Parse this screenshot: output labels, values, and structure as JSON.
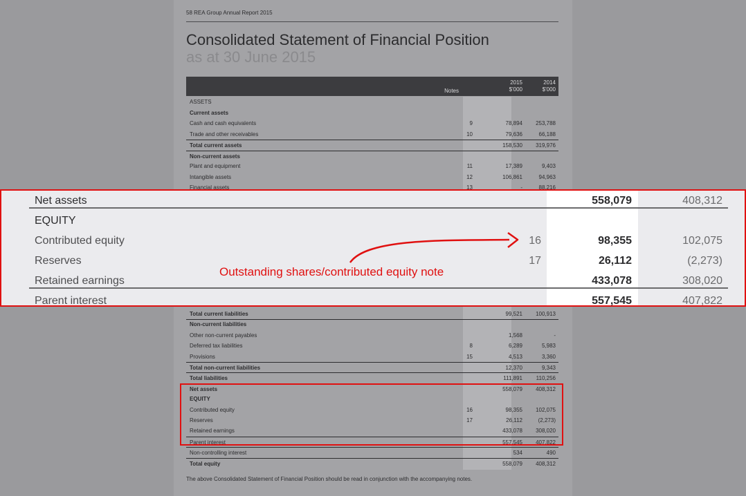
{
  "document": {
    "running_head": "58  REA Group Annual Report 2015",
    "title": "Consolidated Statement of Financial Position",
    "subtitle": "as at 30 June 2015",
    "footnote": "The above Consolidated Statement of Financial Position should be read in conjunction with the accompanying notes."
  },
  "table": {
    "headers": {
      "notes": "Notes",
      "y2015_year": "2015",
      "y2015_unit": "$'000",
      "y2014_year": "2014",
      "y2014_unit": "$'000"
    },
    "top_rows": [
      {
        "label": "ASSETS",
        "note": "",
        "v2015": "",
        "v2014": ""
      },
      {
        "label": "Current assets",
        "note": "",
        "v2015": "",
        "v2014": ""
      },
      {
        "label": "Cash and cash equivalents",
        "note": "9",
        "v2015": "78,894",
        "v2014": "253,788"
      },
      {
        "label": "Trade and other receivables",
        "note": "10",
        "v2015": "79,636",
        "v2014": "66,188"
      },
      {
        "label": "Total current assets",
        "note": "",
        "v2015": "158,530",
        "v2014": "319,976"
      },
      {
        "label": "Non-current assets",
        "note": "",
        "v2015": "",
        "v2014": ""
      },
      {
        "label": "Plant and equipment",
        "note": "11",
        "v2015": "17,389",
        "v2014": "9,403"
      },
      {
        "label": "Intangible assets",
        "note": "12",
        "v2015": "106,861",
        "v2014": "94,963"
      },
      {
        "label": "Financial assets",
        "note": "13",
        "v2015": "-",
        "v2014": "88,216"
      }
    ],
    "bottom_rows": [
      {
        "label": "Total current liabilities",
        "note": "",
        "v2015": "99,521",
        "v2014": "100,913"
      },
      {
        "label": "Non-current liabilities",
        "note": "",
        "v2015": "",
        "v2014": ""
      },
      {
        "label": "Other non-current payables",
        "note": "",
        "v2015": "1,568",
        "v2014": "-"
      },
      {
        "label": "Deferred tax liabilities",
        "note": "8",
        "v2015": "6,289",
        "v2014": "5,983"
      },
      {
        "label": "Provisions",
        "note": "15",
        "v2015": "4,513",
        "v2014": "3,360"
      },
      {
        "label": "Total non-current liabilities",
        "note": "",
        "v2015": "12,370",
        "v2014": "9,343"
      },
      {
        "label": "Total liabilities",
        "note": "",
        "v2015": "111,891",
        "v2014": "110,256"
      },
      {
        "label": "Net assets",
        "note": "",
        "v2015": "558,079",
        "v2014": "408,312"
      },
      {
        "label": "EQUITY",
        "note": "",
        "v2015": "",
        "v2014": ""
      },
      {
        "label": "Contributed equity",
        "note": "16",
        "v2015": "98,355",
        "v2014": "102,075"
      },
      {
        "label": "Reserves",
        "note": "17",
        "v2015": "26,112",
        "v2014": "(2,273)"
      },
      {
        "label": "Retained earnings",
        "note": "",
        "v2015": "433,078",
        "v2014": "308,020"
      },
      {
        "label": "Parent interest",
        "note": "",
        "v2015": "557,545",
        "v2014": "407,822"
      },
      {
        "label": "Non-controlling interest",
        "note": "",
        "v2015": "534",
        "v2014": "490"
      },
      {
        "label": "Total equity",
        "note": "",
        "v2015": "558,079",
        "v2014": "408,312"
      }
    ]
  },
  "zoom": {
    "rows": [
      {
        "label": "Net assets",
        "note": "",
        "v2015": "558,079",
        "v2014": "408,312"
      },
      {
        "label": "EQUITY",
        "note": "",
        "v2015": "",
        "v2014": ""
      },
      {
        "label": "Contributed equity",
        "note": "16",
        "v2015": "98,355",
        "v2014": "102,075"
      },
      {
        "label": "Reserves",
        "note": "17",
        "v2015": "26,112",
        "v2014": "(2,273)"
      },
      {
        "label": "Retained earnings",
        "note": "",
        "v2015": "433,078",
        "v2014": "308,020"
      },
      {
        "label": "Parent interest",
        "note": "",
        "v2015": "557,545",
        "v2014": "407,822"
      }
    ],
    "annotation": "Outstanding shares/contributed equity note"
  },
  "colors": {
    "highlight_red": "#e01010",
    "page_background": "#a3a3a6",
    "header_dark": "#3c3c3f"
  }
}
